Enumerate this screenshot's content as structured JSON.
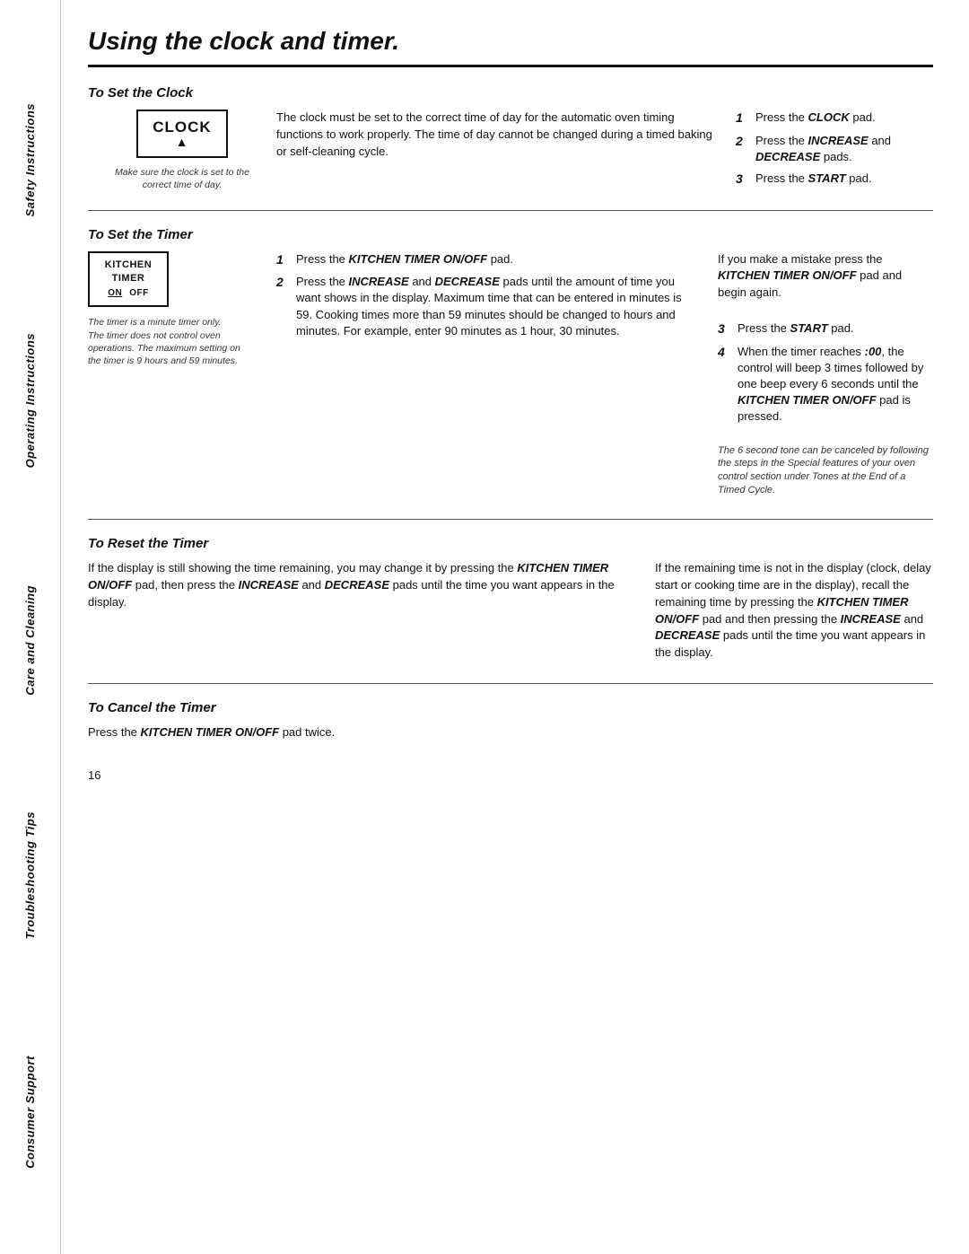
{
  "sidebar": {
    "items": [
      {
        "label": "Safety Instructions"
      },
      {
        "label": "Operating Instructions"
      },
      {
        "label": "Care and Cleaning"
      },
      {
        "label": "Troubleshooting Tips"
      },
      {
        "label": "Consumer Support"
      }
    ]
  },
  "page": {
    "title": "Using the clock and timer.",
    "page_number": "16"
  },
  "set_clock": {
    "heading": "To Set the Clock",
    "clock_label": "CLOCK",
    "clock_caption": "Make sure the clock is set to the correct time of day.",
    "description": "The clock must be set to the correct time of day for the automatic oven timing functions to work properly. The time of day cannot be changed during a timed baking or self-cleaning cycle.",
    "steps": [
      {
        "num": "1",
        "text_plain": "Press the ",
        "bold": "CLOCK",
        "text_after": " pad."
      },
      {
        "num": "2",
        "text_plain": "Press the ",
        "bold": "INCREASE",
        "text_mid": " and ",
        "bold2": "DECREASE",
        "text_after": " pads."
      },
      {
        "num": "3",
        "text_plain": "Press the ",
        "bold": "START",
        "text_after": " pad."
      }
    ]
  },
  "set_timer": {
    "heading": "To Set the Timer",
    "timer_label": "KITCHEN\nTIMER\nON   OFF",
    "timer_caption_lines": [
      "The timer is a minute timer only.",
      "The timer does not control oven operations. The maximum setting on the timer is 9 hours and 59 minutes."
    ],
    "steps_left": [
      {
        "num": "1",
        "text": "Press the KITCHEN TIMER ON/OFF pad."
      },
      {
        "num": "2",
        "text": "Press the INCREASE and DECREASE pads until the amount of time you want shows in the display. Maximum time that can be entered in minutes is 59. Cooking times more than 59 minutes should be changed to hours and minutes. For example, enter 90 minutes as 1 hour, 30 minutes."
      }
    ],
    "steps_right": [
      {
        "num": "note",
        "text": "If you make a mistake press the KITCHEN TIMER ON/OFF pad and begin again."
      },
      {
        "num": "3",
        "text": "Press the START pad."
      },
      {
        "num": "4",
        "text": "When the timer reaches :00, the control will beep 3 times followed by one beep every 6 seconds until the KITCHEN TIMER ON/OFF pad is pressed."
      }
    ],
    "footnote": "The 6 second tone can be canceled by following the steps in the Special features of your oven control section under Tones at the End of a Timed Cycle."
  },
  "reset_timer": {
    "heading": "To Reset the Timer",
    "left_text": "If the display is still showing the time remaining, you may change it by pressing the KITCHEN TIMER ON/OFF pad, then press the INCREASE and DECREASE pads until the time you want appears in the display.",
    "right_text": "If the remaining time is not in the display (clock, delay start or cooking time are in the display), recall the remaining time by pressing the KITCHEN TIMER ON/OFF pad and then pressing the INCREASE and DECREASE pads until the time you want appears in the display."
  },
  "cancel_timer": {
    "heading": "To Cancel the Timer",
    "text": "Press the KITCHEN TIMER ON/OFF pad twice."
  }
}
